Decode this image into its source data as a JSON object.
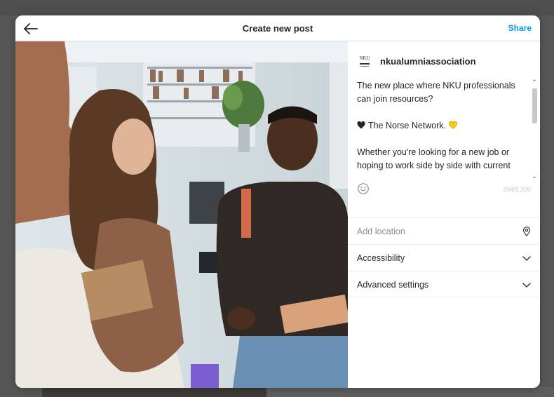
{
  "header": {
    "title": "Create new post",
    "share_label": "Share",
    "back_icon": "arrow-left-icon"
  },
  "post": {
    "username": "nkualumniassociation",
    "avatar_text": "NKU",
    "caption_lines": [
      "The new place where NKU professionals can join resources?",
      "The Norse Network.",
      "Whether you're looking for a new job or hoping to work side by side with current"
    ],
    "char_count": "294/2,200"
  },
  "options": {
    "location_placeholder": "Add location",
    "accessibility_label": "Accessibility",
    "advanced_label": "Advanced settings"
  },
  "colors": {
    "accent": "#0095f6",
    "heart_black": "#262626",
    "heart_yellow": "#f5d000",
    "backdrop": "#565656"
  }
}
